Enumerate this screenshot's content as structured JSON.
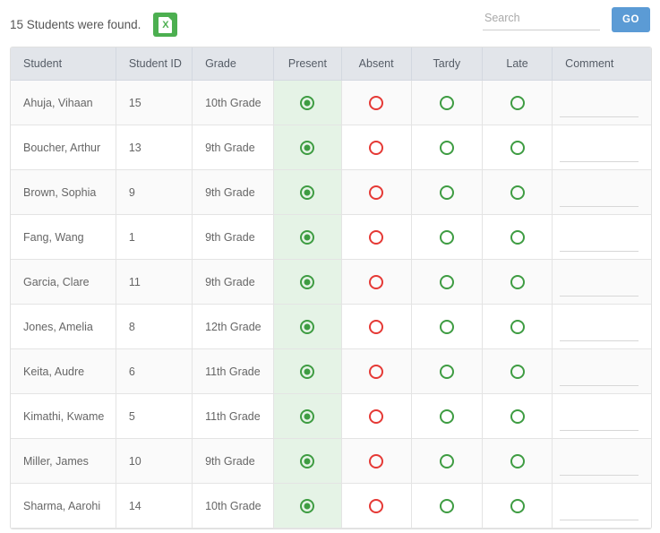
{
  "header": {
    "result_text": "15 Students were found.",
    "export_icon": "excel-file-icon",
    "export_letter": "X"
  },
  "search": {
    "placeholder": "Search",
    "value": "",
    "go_label": "GO"
  },
  "table": {
    "columns": [
      "Student",
      "Student ID",
      "Grade",
      "Present",
      "Absent",
      "Tardy",
      "Late",
      "Comment"
    ],
    "rows": [
      {
        "student": "Ahuja, Vihaan",
        "student_id": "15",
        "grade": "10th Grade",
        "present": true,
        "absent": false,
        "tardy": false,
        "late": false,
        "comment": ""
      },
      {
        "student": "Boucher, Arthur",
        "student_id": "13",
        "grade": "9th Grade",
        "present": true,
        "absent": false,
        "tardy": false,
        "late": false,
        "comment": ""
      },
      {
        "student": "Brown, Sophia",
        "student_id": "9",
        "grade": "9th Grade",
        "present": true,
        "absent": false,
        "tardy": false,
        "late": false,
        "comment": ""
      },
      {
        "student": "Fang, Wang",
        "student_id": "1",
        "grade": "9th Grade",
        "present": true,
        "absent": false,
        "tardy": false,
        "late": false,
        "comment": ""
      },
      {
        "student": "Garcia, Clare",
        "student_id": "11",
        "grade": "9th Grade",
        "present": true,
        "absent": false,
        "tardy": false,
        "late": false,
        "comment": ""
      },
      {
        "student": "Jones, Amelia",
        "student_id": "8",
        "grade": "12th Grade",
        "present": true,
        "absent": false,
        "tardy": false,
        "late": false,
        "comment": ""
      },
      {
        "student": "Keita, Audre",
        "student_id": "6",
        "grade": "11th Grade",
        "present": true,
        "absent": false,
        "tardy": false,
        "late": false,
        "comment": ""
      },
      {
        "student": "Kimathi, Kwame",
        "student_id": "5",
        "grade": "11th Grade",
        "present": true,
        "absent": false,
        "tardy": false,
        "late": false,
        "comment": ""
      },
      {
        "student": "Miller, James",
        "student_id": "10",
        "grade": "9th Grade",
        "present": true,
        "absent": false,
        "tardy": false,
        "late": false,
        "comment": ""
      },
      {
        "student": "Sharma, Aarohi",
        "student_id": "14",
        "grade": "10th Grade",
        "present": true,
        "absent": false,
        "tardy": false,
        "late": false,
        "comment": ""
      }
    ]
  },
  "colors": {
    "present_cell_bg": "#e5f3e6",
    "radio_green": "#3e9c42",
    "radio_red": "#e53935",
    "go_button": "#5b9bd5",
    "export_green": "#4caf50",
    "header_bg": "#e2e5ea"
  }
}
